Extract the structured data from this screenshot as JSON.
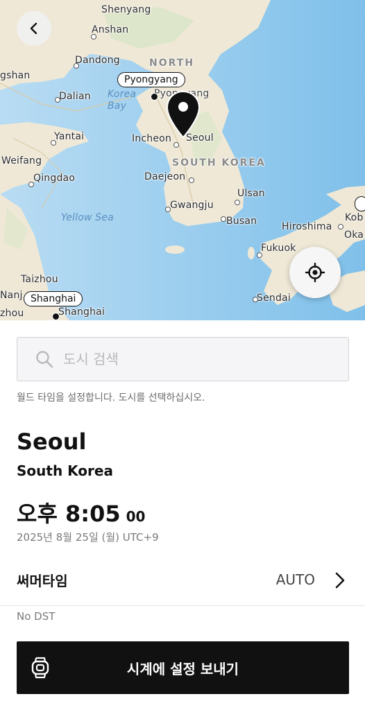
{
  "map": {
    "labels": {
      "shenyang": "Shenyang",
      "anshan": "Anshan",
      "dandong": "Dandong",
      "north": "NORTH",
      "gshan": "gshan",
      "dalian": "Dalian",
      "korea_bay": "Korea\nBay",
      "pyongyang_under": "Pyongyang",
      "yantai": "Yantai",
      "incheon": "Incheon",
      "seoul": "Seoul",
      "weifang": "Weifang",
      "south_korea": "SOUTH KOREA",
      "qingdao": "Qingdao",
      "daejeon": "Daejeon",
      "ulsan": "Ulsan",
      "gwangju": "Gwangju",
      "busan": "Busan",
      "yellow_sea": "Yellow Sea",
      "hiroshima": "Hiroshima",
      "kob": "Kob",
      "oka": "Oka",
      "fukuoka": "Fukuok",
      "taizhou": "Taizhou",
      "nanj": "Nanj",
      "sendai": "Sendai",
      "zhou": "zhou",
      "shanghai_under": "Shanghai"
    },
    "pills": {
      "pyongyang": "Pyongyang",
      "shanghai": "Shanghai"
    }
  },
  "icons": {
    "back": "chevron-left-icon",
    "locate": "crosshair-location-icon",
    "search": "search-icon",
    "pin": "map-pin-icon",
    "chevron": "chevron-right-icon",
    "watch": "smartwatch-icon"
  },
  "search": {
    "placeholder": "도시 검색",
    "hint": "월드 타임을 설정합니다. 도시를 선택하십시오."
  },
  "selection": {
    "city": "Seoul",
    "country": "South Korea",
    "time": "오후 8:05",
    "seconds": "00",
    "date": "2025년 8월 25일 (월) UTC+9"
  },
  "dst": {
    "label": "써머타임",
    "value": "AUTO",
    "note": "No DST"
  },
  "send_button": {
    "label": "시계에 설정 보내기"
  },
  "colors": {
    "sea": "#a9d3f0",
    "land": "#efe8d6",
    "button": "#111111"
  }
}
